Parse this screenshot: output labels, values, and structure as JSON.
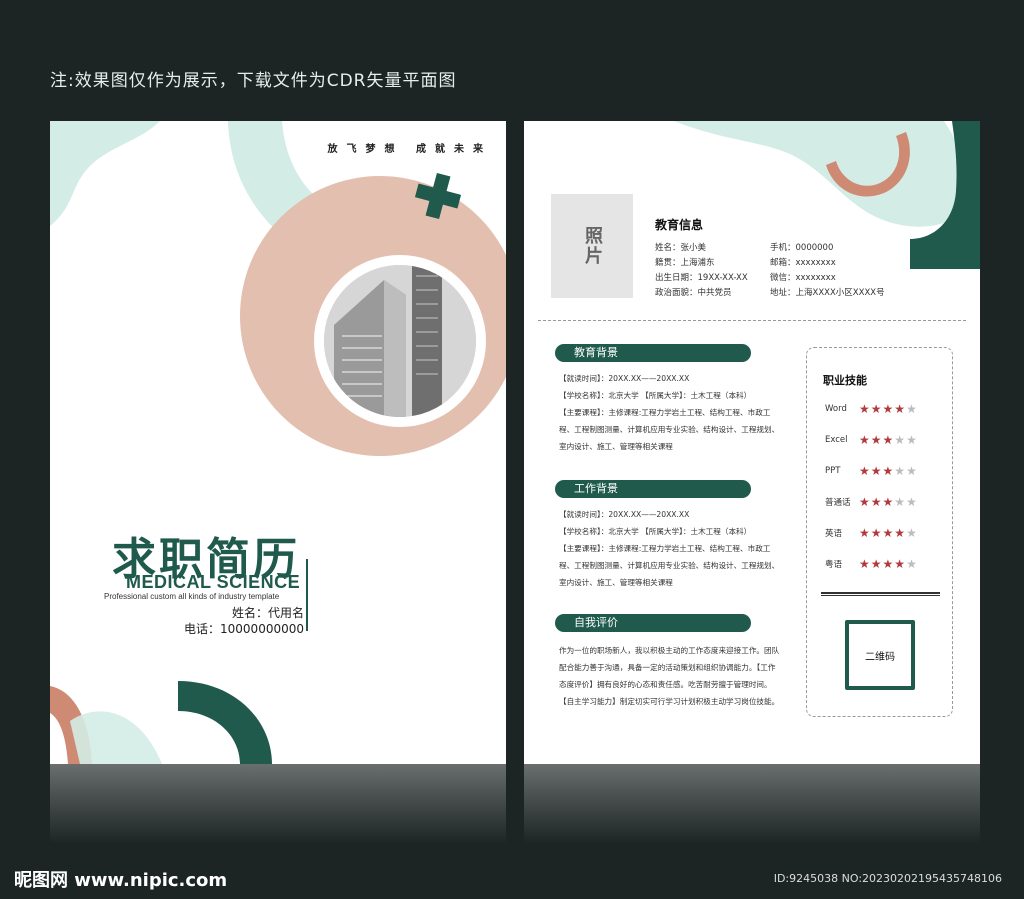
{
  "top_note": "注:效果图仅作为展示，下载文件为CDR矢量平面图",
  "left_page": {
    "slogan": "放飞梦想 成就未来",
    "title_cn": "求职简历",
    "title_en": "MEDICAL SCIENCE",
    "subtitle_en": "Professional custom all kinds of industry  template",
    "name_line": "姓名：代用名",
    "phone_line": "电话：10000000000"
  },
  "right_page": {
    "photo_label": "照片",
    "edu_info_title": "教育信息",
    "info_rows": [
      {
        "left": "姓名：张小美",
        "right": "手机：0000000"
      },
      {
        "left": "籍贯：上海浦东",
        "right": "邮箱：xxxxxxxx"
      },
      {
        "left": "出生日期：19XX-XX-XX",
        "right": "微信：xxxxxxxx"
      },
      {
        "left": "政治面貌：中共党员",
        "right": "地址：上海XXXX小区XXXX号"
      }
    ],
    "education": {
      "title": "教育背景",
      "lines": [
        "【就读时间】：20XX.XX——20XX.XX",
        "【学校名称】：北京大学      【所属大学】：土木工程（本科）",
        "【主要课程】：主修课程:工程力学岩土工程、结构工程、市政工",
        "程、工程制图测量、计算机应用专业实验、结构设计、工程规划、",
        "室内设计、施工、管理等相关课程"
      ]
    },
    "work": {
      "title": "工作背景",
      "lines": [
        "【就读时间】：20XX.XX——20XX.XX",
        "【学校名称】：北京大学      【所属大学】：土木工程（本科）",
        "【主要课程】：主修课程:工程力学岩土工程、结构工程、市政工",
        "程、工程制图测量、计算机应用专业实验、结构设计、工程规划、",
        "室内设计、施工、管理等相关课程"
      ]
    },
    "self_eval": {
      "title": "自我评价",
      "lines": [
        "作为一位的职场新人，我以积极主动的工作态度来迎接工作。团队",
        "配合能力善于沟通，具备一定的活动策划和组织协调能力。【工作",
        "态度评价】拥有良好的心态和责任感。吃苦耐劳擅于管理时间。",
        "【自主学习能力】制定切实可行学习计划积极主动学习岗位技能。"
      ]
    },
    "skills": {
      "title": "职业技能",
      "items": [
        {
          "name": "Word",
          "rating": 4
        },
        {
          "name": "Excel",
          "rating": 3
        },
        {
          "name": "PPT",
          "rating": 3
        },
        {
          "name": "普通话",
          "rating": 3
        },
        {
          "name": "英语",
          "rating": 4
        },
        {
          "name": "粤语",
          "rating": 4
        }
      ],
      "max_rating": 5,
      "qr_label": "二维码"
    }
  },
  "footer": {
    "logo_text": "昵图网 www.nipic.com",
    "id_text": "ID:9245038 NO:20230202195435748106"
  },
  "colors": {
    "dark_green": "#1f5a4d",
    "mint": "#d4ece6",
    "salmon": "#e0b8a8",
    "terracotta": "#cf8a74",
    "star_on": "#b03a3e",
    "star_off": "#bcbcbc"
  }
}
